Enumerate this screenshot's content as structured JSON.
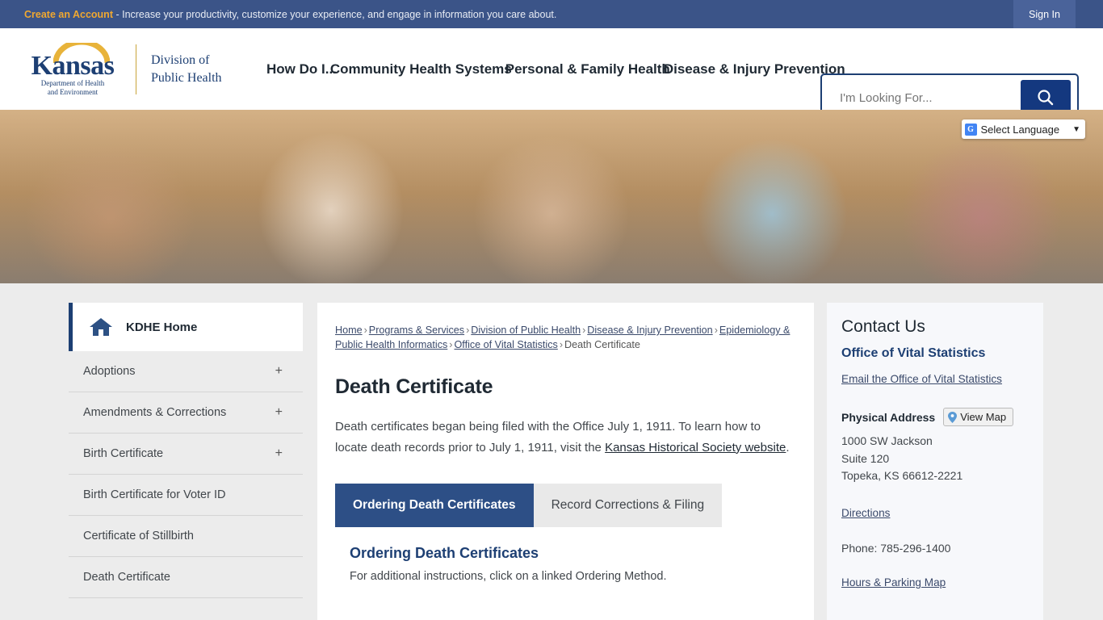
{
  "topbar": {
    "cta_label": "Create an Account",
    "tagline": " - Increase your productivity, customize your experience, and engage in information you care about.",
    "signin_label": "Sign In"
  },
  "header": {
    "logo": {
      "wordmark": "Kansas",
      "subline1": "Department of Health",
      "subline2": "and Environment",
      "division_line1": "Division of",
      "division_line2": "Public Health"
    },
    "nav": [
      {
        "label": "How Do I..."
      },
      {
        "label": "Community Health Systems"
      },
      {
        "label": "Personal & Family Health"
      },
      {
        "label": "Disease & Injury Prevention"
      }
    ],
    "search": {
      "placeholder": "I'm Looking For...",
      "value": "",
      "icon": "search-icon"
    }
  },
  "hero": {
    "language_selector": {
      "label": "Select Language",
      "badge": "G",
      "caret": "⌄"
    }
  },
  "sidebar": {
    "home": {
      "label": "KDHE Home",
      "icon": "home-icon"
    },
    "items": [
      {
        "label": "Adoptions",
        "expander": "+"
      },
      {
        "label": "Amendments & Corrections",
        "expander": "+"
      },
      {
        "label": "Birth Certificate",
        "expander": "+"
      },
      {
        "label": "Birth Certificate for Voter ID",
        "expander": ""
      },
      {
        "label": "Certificate of Stillbirth",
        "expander": ""
      },
      {
        "label": "Death Certificate",
        "expander": ""
      }
    ]
  },
  "breadcrumb": {
    "items": [
      "Home",
      "Programs & Services",
      "Division of Public Health",
      "Disease & Injury Prevention",
      "Epidemiology & Public Health Informatics",
      "Office of Vital Statistics"
    ],
    "current": "Death Certificate",
    "separator": "›"
  },
  "main": {
    "title": "Death Certificate",
    "intro_before": "Death certificates began being filed with the Office July 1, 1911. To learn how to locate death records prior to July 1, 1911, visit the ",
    "intro_link": "Kansas Historical Society website",
    "intro_after": ".",
    "tabs": [
      {
        "label": "Ordering Death Certificates",
        "active": true
      },
      {
        "label": "Record Corrections & Filing",
        "active": false
      }
    ],
    "panel": {
      "heading": "Ordering Death Certificates",
      "text": "For additional instructions, click on a linked Ordering Method."
    }
  },
  "contact": {
    "heading": "Contact Us",
    "office": "Office of Vital Statistics",
    "email_link": "Email the Office of Vital Statistics",
    "address_label": "Physical Address",
    "view_map_label": "View Map",
    "map_pin_icon": "map-pin-icon",
    "address_lines": [
      "1000 SW Jackson",
      "Suite 120",
      "Topeka, KS 66612-2221"
    ],
    "directions_link": "Directions",
    "phone": "Phone: 785-296-1400",
    "hours_link": "Hours & Parking Map"
  },
  "colors": {
    "navy": "#1d3f73",
    "topbar_blue": "#3b5488",
    "gold": "#f0a830",
    "tab_active": "#2d4f86"
  }
}
